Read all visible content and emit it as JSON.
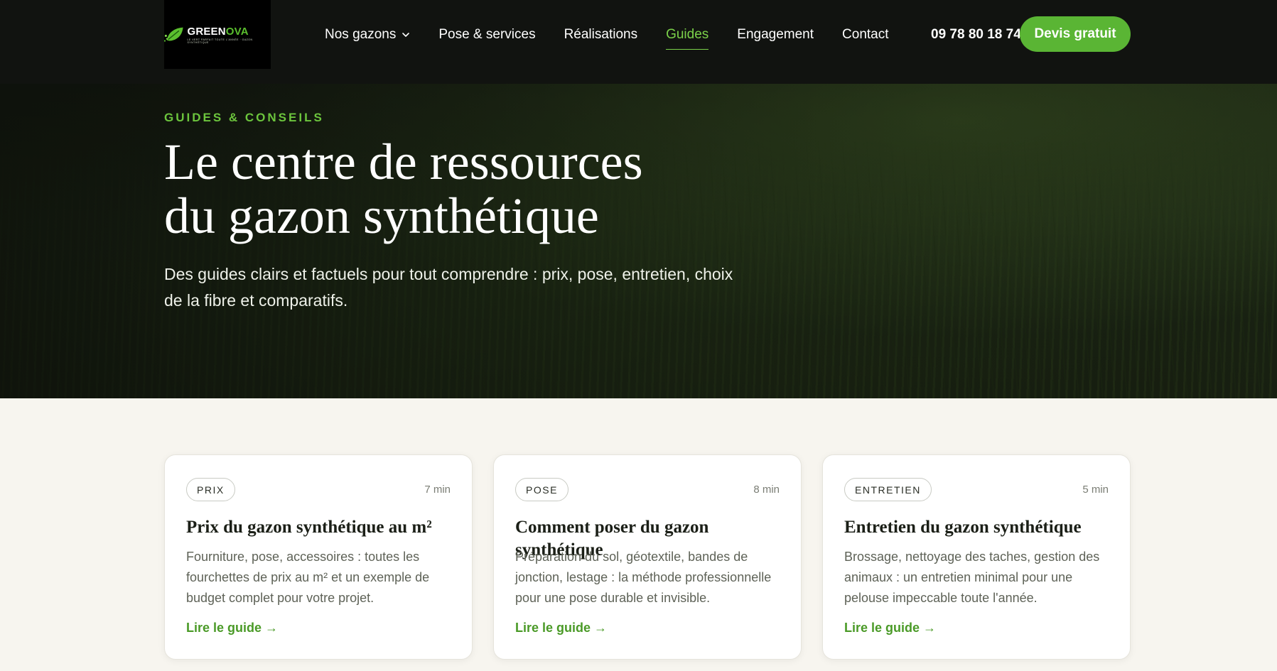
{
  "brand": {
    "name_part1": "GREEN",
    "name_part2": "OVA",
    "tagline": "LE VERT PARFAIT TOUTE L'ANNÉE · GAZON SYNTHÉTIQUE",
    "accent_color": "#5ab534",
    "logo_icon": "leaf-icon"
  },
  "nav": {
    "items": [
      {
        "label": "Nos gazons",
        "has_dropdown": true
      },
      {
        "label": "Pose & services"
      },
      {
        "label": "Réalisations"
      },
      {
        "label": "Guides",
        "active": true
      },
      {
        "label": "Engagement"
      },
      {
        "label": "Contact"
      }
    ],
    "phone": "09 78 80 18 74",
    "cta_label": "Devis gratuit",
    "dropdown_icon": "chevron-down-icon"
  },
  "hero": {
    "eyebrow": "GUIDES & CONSEILS",
    "title_line1": "Le centre de ressources",
    "title_line2": "du gazon synthétique",
    "subtitle": "Des guides clairs et factuels pour tout comprendre : prix, pose, entretien, choix de la fibre et comparatifs."
  },
  "cards": [
    {
      "tag": "PRIX",
      "time": "7 min",
      "title": "Prix du gazon synthétique au m²",
      "description": "Fourniture, pose, accessoires : toutes les fourchettes de prix au m² et un exemple de budget complet pour votre projet.",
      "link_label": "Lire le guide →"
    },
    {
      "tag": "POSE",
      "time": "8 min",
      "title": "Comment poser du gazon synthétique",
      "description": "Préparation du sol, géotextile, bandes de jonction, lestage : la méthode professionnelle pour une pose durable et invisible.",
      "link_label": "Lire le guide →"
    },
    {
      "tag": "ENTRETIEN",
      "time": "5 min",
      "title": "Entretien du gazon synthétique",
      "description": "Brossage, nettoyage des taches, gestion des animaux : un entretien minimal pour une pelouse impeccable toute l'année.",
      "link_label": "Lire le guide →"
    }
  ]
}
